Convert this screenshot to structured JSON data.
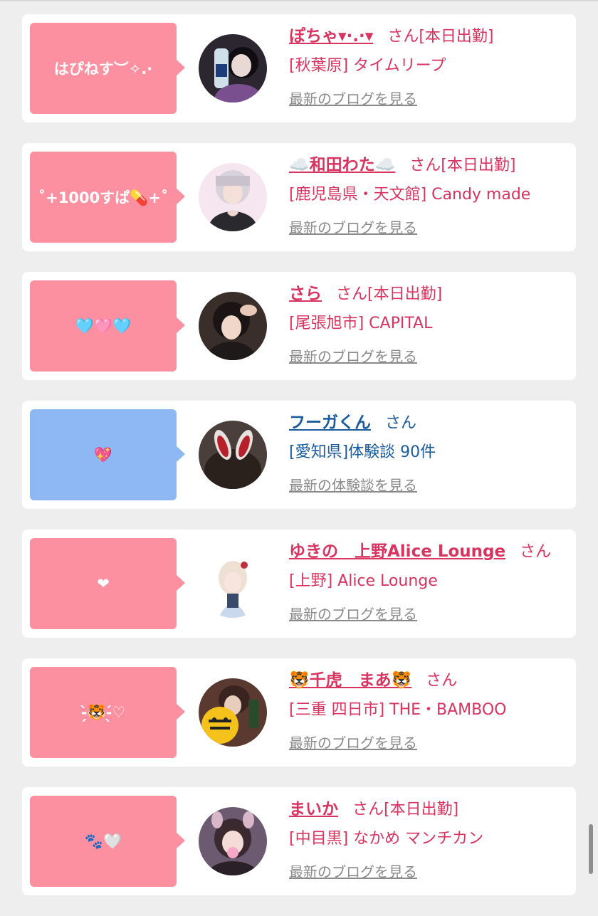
{
  "colors": {
    "pink_bubble": "#fc8fa0",
    "blue_bubble": "#8db8f4",
    "pink_text": "#d8345f",
    "blue_text": "#1a5c9e",
    "link_gray": "#8a8a8a",
    "background": "#eeeeee"
  },
  "cards": [
    {
      "theme": "pink",
      "message": "はぴねす︶✧.·",
      "name": "ぽちゃ▾·.·▾",
      "suffix": "さん",
      "status": "[本日出勤]",
      "shop": "[秋葉原] タイムリープ",
      "link": "最新のブログを見る"
    },
    {
      "theme": "pink",
      "message": "˚+1000すぱ💊+˚",
      "name": "☁️和田わた☁️",
      "suffix": "さん",
      "status": "[本日出勤]",
      "shop": "[鹿児島県・天文館] Candy made",
      "link": "最新のブログを見る"
    },
    {
      "theme": "pink",
      "message": "🩵🩷🩵",
      "name": "さら",
      "suffix": "さん",
      "status": "[本日出勤]",
      "shop": "[尾張旭市] CAPITAL",
      "link": "最新のブログを見る"
    },
    {
      "theme": "blue",
      "message": "💖",
      "name": "フーガくん",
      "suffix": "さん",
      "status": "",
      "shop": "[愛知県]体験談 90件",
      "link": "最新の体験談を見る"
    },
    {
      "theme": "pink",
      "message": "❤",
      "name": "ゆきの　上野Alice Lounge",
      "suffix": "さん",
      "status": "",
      "shop": "[上野] Alice Lounge",
      "link": "最新のブログを見る"
    },
    {
      "theme": "pink",
      "message": "-̗̀🐯-̖́♡",
      "name": "🐯千虎　まあ🐯",
      "suffix": "さん",
      "status": "",
      "shop": "[三重 四日市] THE・BAMBOO",
      "link": "最新のブログを見る"
    },
    {
      "theme": "pink",
      "message": "🐾🤍",
      "name": "まいか",
      "suffix": "さん",
      "status": "[本日出勤]",
      "shop": "[中目黒] なかめ マンチカン",
      "link": "最新のブログを見る"
    }
  ]
}
